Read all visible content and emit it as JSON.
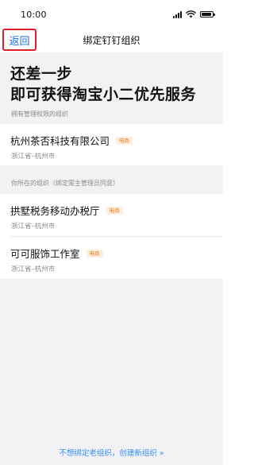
{
  "status_bar": {
    "time": "10:00",
    "icons": [
      "signal-icon",
      "wifi-icon",
      "battery-icon"
    ]
  },
  "nav": {
    "back_label": "返回",
    "title": "绑定钉钉组织"
  },
  "hero": {
    "line1": "还差一步",
    "line2": "即可获得淘宝小二优先服务"
  },
  "sections": {
    "admin_header": "拥有管理权限的组织",
    "member_header": "你所在的组织（绑定需主管理员同意）"
  },
  "admin_orgs": [
    {
      "name": "杭州茶否科技有限公司",
      "tag": "电商",
      "location": "浙江省–杭州市"
    }
  ],
  "member_orgs": [
    {
      "name": "拱墅税务移动办税厅",
      "tag": "电商",
      "location": "浙江省–杭州市"
    },
    {
      "name": "可可服饰工作室",
      "tag": "电商",
      "location": "浙江省–杭州市"
    }
  ],
  "footer": {
    "create_link": "不想绑定老组织，创建新组织 »"
  },
  "colors": {
    "accent_blue": "#1a6fe6",
    "link_blue": "#3a8ef0",
    "highlight_red": "#e0202a",
    "tag_orange": "#f07a1f",
    "tag_bg": "#fdeede",
    "page_bg": "#f2f2f4"
  }
}
